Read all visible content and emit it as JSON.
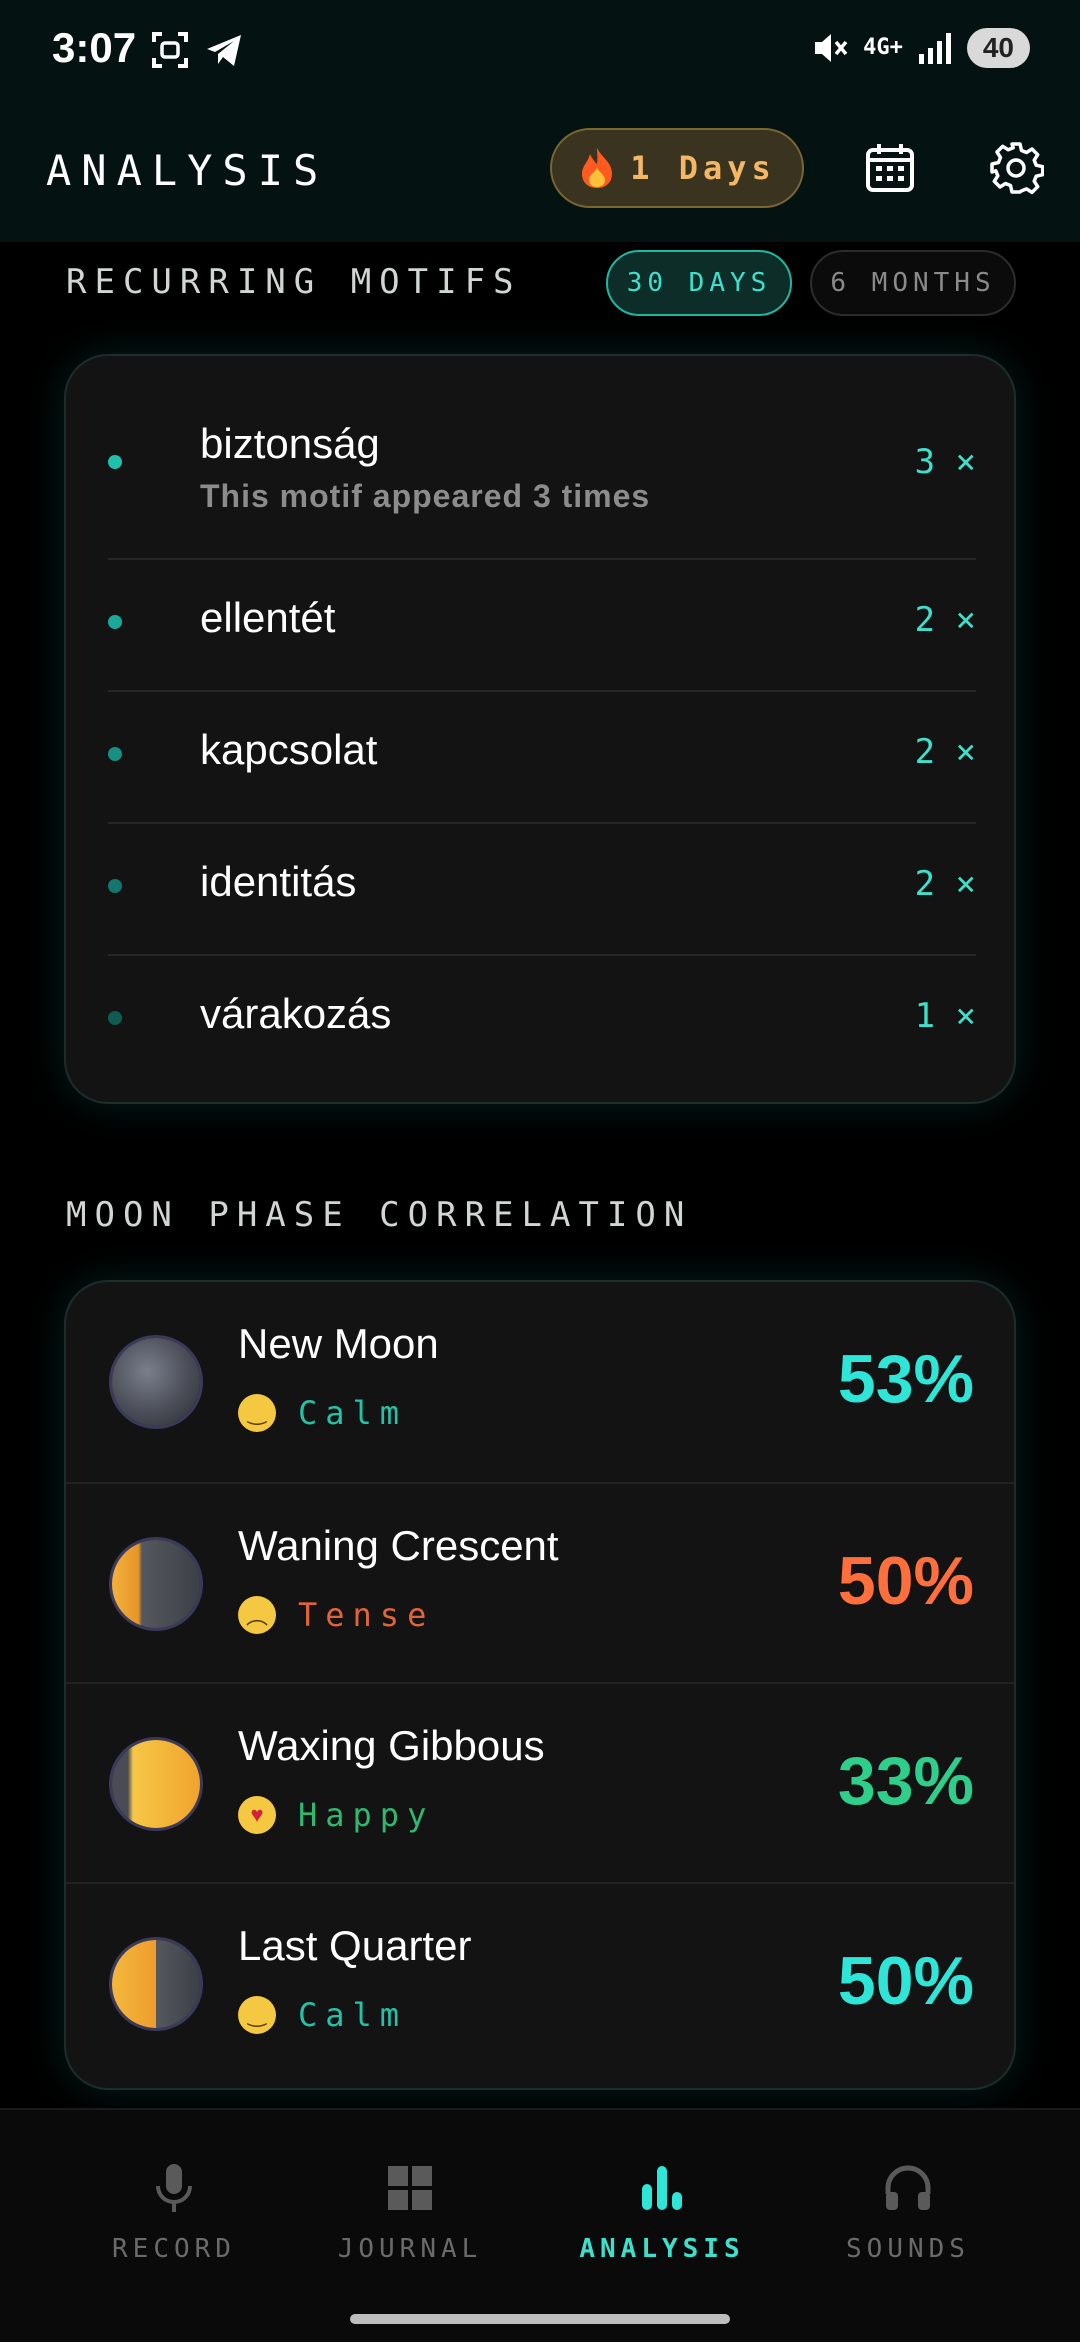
{
  "status_bar": {
    "time": "3:07",
    "network": "4G+",
    "battery": "40"
  },
  "header": {
    "title": "ANALYSIS",
    "streak_label": "1 Days"
  },
  "motifs": {
    "title": "RECURRING MOTIFS",
    "filters": [
      "30 DAYS",
      "6 MONTHS"
    ],
    "items": [
      {
        "name": "biztonság",
        "subtitle": "This motif appeared 3 times",
        "count": "3 ×"
      },
      {
        "name": "ellentét",
        "count": "2 ×"
      },
      {
        "name": "kapcsolat",
        "count": "2 ×"
      },
      {
        "name": "identitás",
        "count": "2 ×"
      },
      {
        "name": "várakozás",
        "count": "1 ×"
      }
    ]
  },
  "moon": {
    "title": "MOON PHASE CORRELATION",
    "rows": [
      {
        "phase": "New Moon",
        "mood": "Calm",
        "percent": "53%",
        "color": "#2ee6d8"
      },
      {
        "phase": "Waning Crescent",
        "mood": "Tense",
        "percent": "50%",
        "color": "#ff6f3c"
      },
      {
        "phase": "Waxing Gibbous",
        "mood": "Happy",
        "percent": "33%",
        "color": "#2ecf8a"
      },
      {
        "phase": "Last Quarter",
        "mood": "Calm",
        "percent": "50%",
        "color": "#2ee6d8"
      }
    ]
  },
  "nav": {
    "items": [
      {
        "label": "RECORD",
        "icon": "mic-icon"
      },
      {
        "label": "JOURNAL",
        "icon": "grid-icon"
      },
      {
        "label": "ANALYSIS",
        "icon": "bar-chart-icon",
        "active": true
      },
      {
        "label": "SOUNDS",
        "icon": "headphones-icon"
      }
    ]
  }
}
